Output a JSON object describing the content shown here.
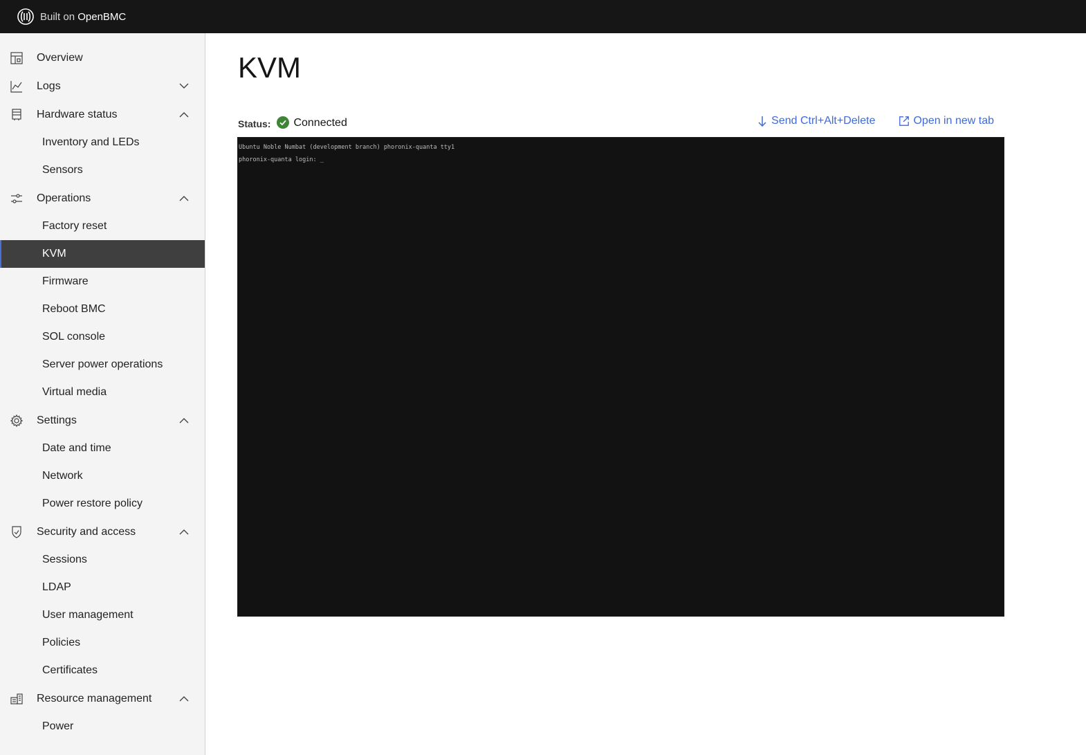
{
  "header": {
    "brand_prefix": "Built on",
    "brand_name": "OpenBMC",
    "logo_icon": "openbmc-logo-icon"
  },
  "sidebar": {
    "overview": "Overview",
    "logs": "Logs",
    "hardware_status": "Hardware status",
    "inventory": "Inventory and LEDs",
    "sensors": "Sensors",
    "operations": "Operations",
    "factory_reset": "Factory reset",
    "kvm": "KVM",
    "firmware": "Firmware",
    "reboot_bmc": "Reboot BMC",
    "sol_console": "SOL console",
    "server_power": "Server power operations",
    "virtual_media": "Virtual media",
    "settings": "Settings",
    "date_time": "Date and time",
    "network": "Network",
    "power_restore": "Power restore policy",
    "security": "Security and access",
    "sessions": "Sessions",
    "ldap": "LDAP",
    "user_management": "User management",
    "policies": "Policies",
    "certificates": "Certificates",
    "resource_management": "Resource management",
    "power": "Power"
  },
  "main": {
    "title": "KVM",
    "status_label": "Status:",
    "status_value": "Connected",
    "status_color": "#3e8635",
    "send_ctrl_alt_del": "Send Ctrl+Alt+Delete",
    "open_new_tab": "Open in new tab",
    "accent_color": "#3f6ad8"
  },
  "console": {
    "line1": "Ubuntu Noble Numbat (development branch) phoronix-quanta tty1",
    "line2": "phoronix-quanta login: _"
  }
}
